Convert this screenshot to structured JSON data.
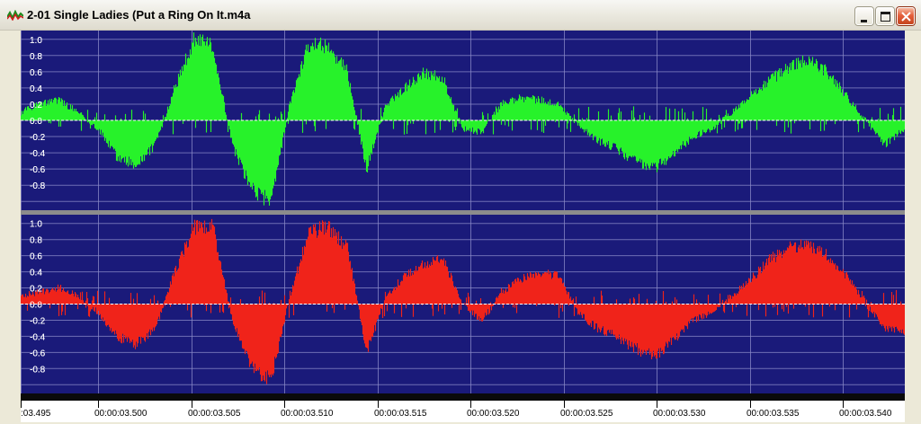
{
  "window": {
    "title": "2-01 Single Ladies (Put a Ring On It.m4a",
    "icon": "waveform-icon",
    "controls": [
      "minimize-icon",
      "maximize-icon",
      "close-icon"
    ]
  },
  "colors": {
    "plot_bg": "#1a1a7a",
    "grid": "#8a8ac8",
    "channel_left": "#27f22a",
    "channel_right": "#f0231a",
    "zero_line": "#ffffff"
  },
  "y_ticks": [
    "1.0",
    "0.8",
    "0.6",
    "0.4",
    "0.2",
    "0.0",
    "-0.2",
    "-0.4",
    "-0.6",
    "-0.8"
  ],
  "time_ticks": [
    ":03.495",
    "00:00:03.500",
    "00:00:03.505",
    "00:00:03.510",
    "00:00:03.515",
    "00:00:03.520",
    "00:00:03.525",
    "00:00:03.530",
    "00:00:03.535",
    "00:00:03.540"
  ],
  "chart_data": {
    "type": "area",
    "x": [
      3.495,
      3.496,
      3.497,
      3.498,
      3.499,
      3.5,
      3.501,
      3.502,
      3.503,
      3.504,
      3.505,
      3.506,
      3.507,
      3.508,
      3.509,
      3.51,
      3.511,
      3.512,
      3.513,
      3.514,
      3.515,
      3.516,
      3.517,
      3.518,
      3.519,
      3.52,
      3.521,
      3.522,
      3.523,
      3.524,
      3.525,
      3.526,
      3.527,
      3.528,
      3.529,
      3.53,
      3.531,
      3.532,
      3.533,
      3.534,
      3.535,
      3.536,
      3.537,
      3.538,
      3.539,
      3.54,
      3.541
    ],
    "xlabel": "",
    "ylabel": "",
    "ylim": [
      -1.0,
      1.0
    ],
    "series": [
      {
        "values": [
          0.1,
          0.2,
          0.25,
          0.1,
          -0.1,
          -0.45,
          -0.55,
          -0.3,
          0.4,
          1.0,
          0.9,
          -0.3,
          -0.85,
          -1.0,
          0.2,
          0.95,
          0.9,
          0.6,
          -0.6,
          0.2,
          0.4,
          0.6,
          0.5,
          -0.1,
          -0.15,
          0.2,
          0.28,
          0.25,
          0.2,
          -0.05,
          -0.25,
          -0.35,
          -0.5,
          -0.6,
          -0.4,
          -0.2,
          -0.1,
          0.1,
          0.3,
          0.5,
          0.65,
          0.75,
          0.6,
          0.3,
          0.0,
          -0.3,
          -0.1
        ]
      },
      {
        "values": [
          0.1,
          0.15,
          0.2,
          0.1,
          -0.1,
          -0.4,
          -0.5,
          -0.3,
          0.4,
          0.95,
          0.95,
          -0.2,
          -0.8,
          -0.95,
          0.1,
          0.9,
          0.95,
          0.7,
          -0.6,
          0.1,
          0.35,
          0.5,
          0.55,
          0.0,
          -0.2,
          0.15,
          0.3,
          0.4,
          0.35,
          -0.1,
          -0.3,
          -0.4,
          -0.55,
          -0.65,
          -0.45,
          -0.2,
          -0.1,
          0.1,
          0.3,
          0.55,
          0.7,
          0.75,
          0.6,
          0.35,
          0.0,
          -0.3,
          -0.35
        ]
      }
    ]
  }
}
